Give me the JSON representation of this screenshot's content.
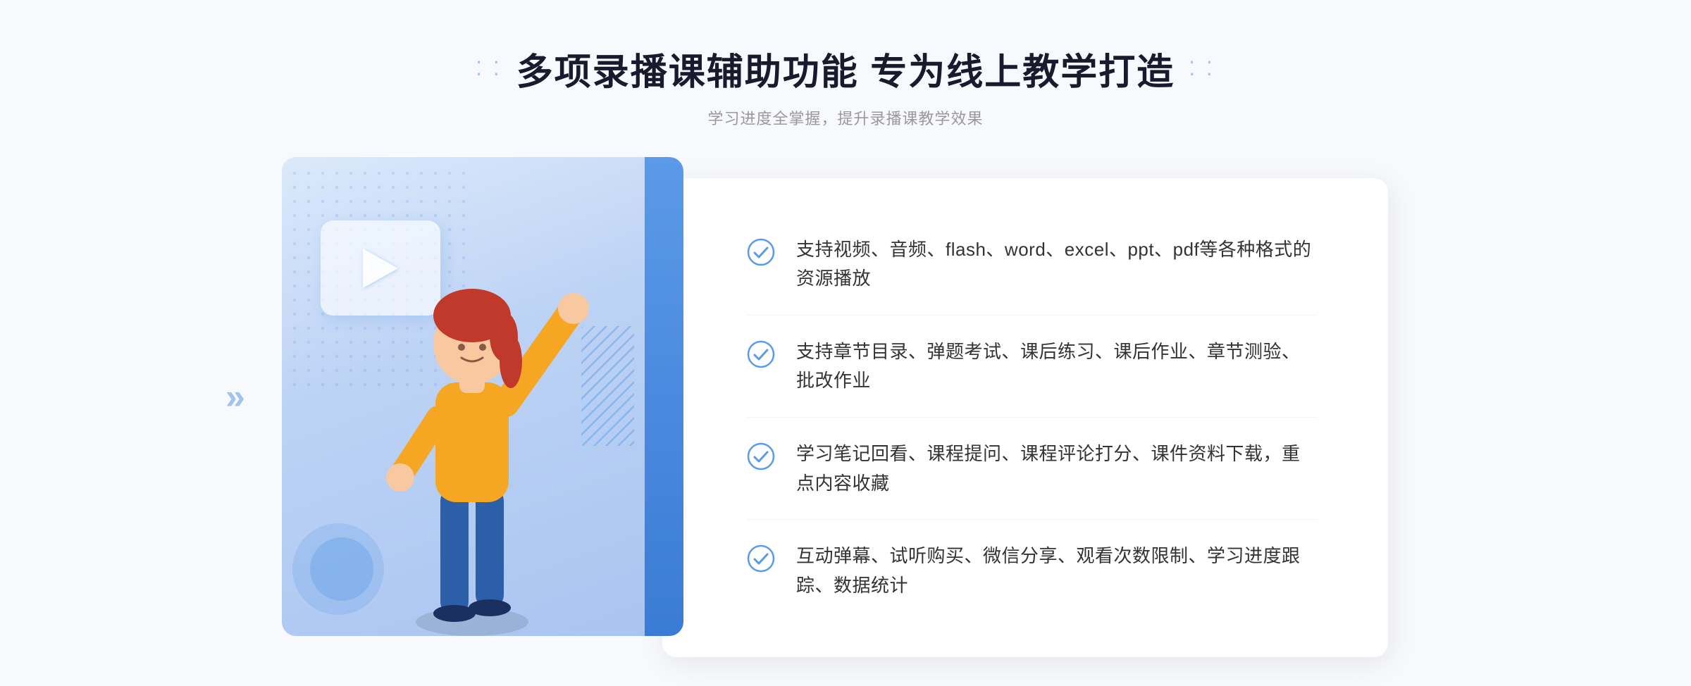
{
  "header": {
    "title": "多项录播课辅助功能 专为线上教学打造",
    "subtitle": "学习进度全掌握，提升录播课教学效果",
    "dots_left": "⁞⁞",
    "dots_right": "⁞⁞"
  },
  "features": [
    {
      "id": 1,
      "text": "支持视频、音频、flash、word、excel、ppt、pdf等各种格式的资源播放"
    },
    {
      "id": 2,
      "text": "支持章节目录、弹题考试、课后练习、课后作业、章节测验、批改作业"
    },
    {
      "id": 3,
      "text": "学习笔记回看、课程提问、课程评论打分、课件资料下载，重点内容收藏"
    },
    {
      "id": 4,
      "text": "互动弹幕、试听购买、微信分享、观看次数限制、学习进度跟踪、数据统计"
    }
  ],
  "colors": {
    "primary_blue": "#4a90e2",
    "light_blue": "#3a7bd5",
    "bg_gray": "#f5f7fc",
    "text_dark": "#2c2c2c",
    "text_gray": "#999999",
    "check_color": "#5b9ae8"
  }
}
